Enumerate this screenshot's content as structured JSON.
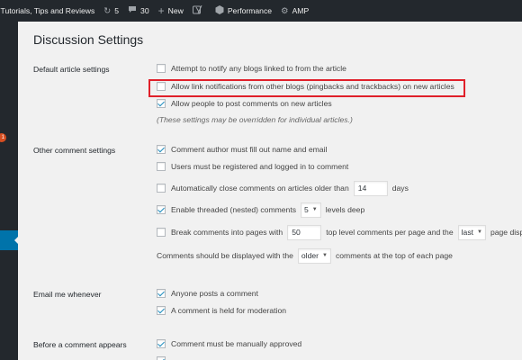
{
  "admin_bar": {
    "site_name": "s Tutorials, Tips and Reviews",
    "updates_count": "5",
    "comments_count": "30",
    "new_label": "New",
    "performance_label": "Performance",
    "amp_label": "AMP"
  },
  "admin_menu": {
    "badge": "1"
  },
  "page_title": "Discussion Settings",
  "sections": {
    "default_article": {
      "label": "Default article settings",
      "items": [
        {
          "label": "Attempt to notify any blogs linked to from the article",
          "checked": false
        },
        {
          "label": "Allow link notifications from other blogs (pingbacks and trackbacks) on new articles",
          "checked": false
        },
        {
          "label": "Allow people to post comments on new articles",
          "checked": true
        }
      ],
      "note": "(These settings may be overridden for individual articles.)"
    },
    "other_comment": {
      "label": "Other comment settings",
      "author_name_email": "Comment author must fill out name and email",
      "registered_logged_in": "Users must be registered and logged in to comment",
      "auto_close_prefix": "Automatically close comments on articles older than",
      "auto_close_days": "14",
      "auto_close_suffix": "days",
      "threaded_prefix": "Enable threaded (nested) comments",
      "threaded_levels": "5",
      "threaded_suffix": "levels deep",
      "break_prefix": "Break comments into pages with",
      "break_count": "50",
      "break_middle": "top level comments per page and the",
      "break_page": "last",
      "break_suffix": "page displ",
      "display_prefix": "Comments should be displayed with the",
      "display_order": "older",
      "display_suffix": "comments at the top of each page"
    },
    "email_me": {
      "label": "Email me whenever",
      "anyone_posts": "Anyone posts a comment",
      "held_for_moderation": "A comment is held for moderation"
    },
    "before_appears": {
      "label": "Before a comment appears",
      "manually_approved": "Comment must be manually approved"
    }
  },
  "colors": {
    "admin_bar_bg": "#23282d",
    "accent": "#0073aa",
    "highlight": "#e0202a",
    "badge": "#d54e21"
  }
}
